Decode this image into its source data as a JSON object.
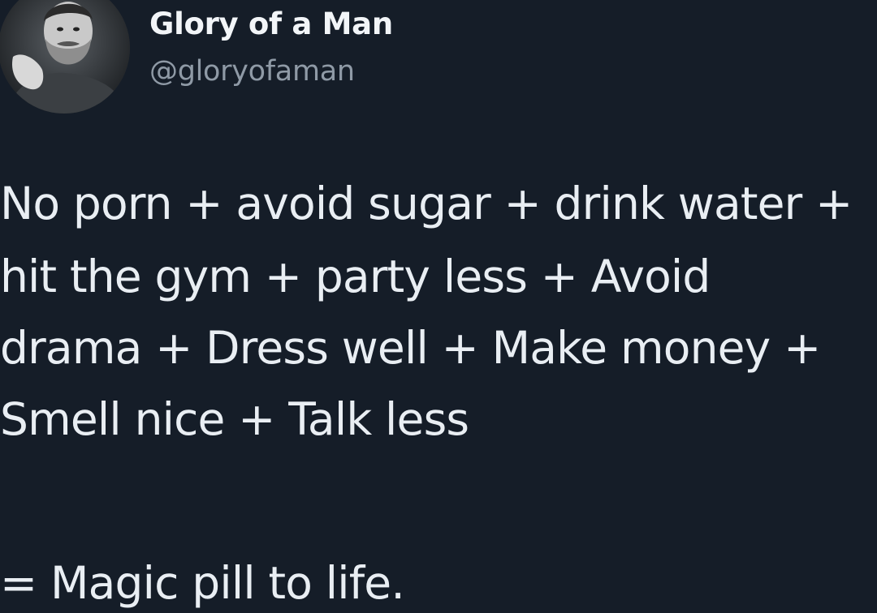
{
  "author": {
    "name": "Glory of a Man",
    "handle": "@gloryofaman",
    "avatar_icon": "bearded-man-portrait"
  },
  "tweet": {
    "lines": [
      "No porn + avoid sugar + drink water +",
      "hit the gym + party less + Avoid",
      "drama + Dress well + Make money +",
      "Smell nice + Talk less",
      "= Magic pill to life."
    ]
  },
  "colors": {
    "background": "#151d28",
    "text": "#e9eef3",
    "handle": "#8f9aa6"
  }
}
